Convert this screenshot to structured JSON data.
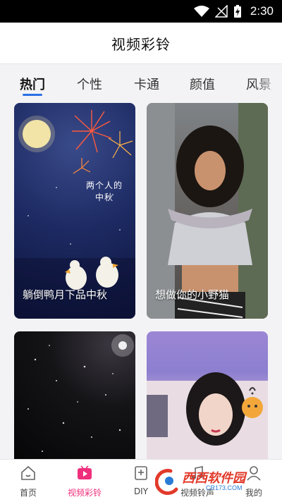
{
  "status_bar": {
    "time": "2:30"
  },
  "header": {
    "title": "视频彩铃"
  },
  "tabs": [
    {
      "label": "热门",
      "active": true
    },
    {
      "label": "个性"
    },
    {
      "label": "卡通"
    },
    {
      "label": "颜值"
    },
    {
      "label": "风景"
    }
  ],
  "cards": [
    {
      "caption": "躺倒鸭月下品中秋",
      "overlay_text": "两个人的中秋"
    },
    {
      "caption": "想做你的小野猫"
    },
    {
      "caption": ""
    },
    {
      "caption": ""
    }
  ],
  "bottom_nav": [
    {
      "label": "首页",
      "icon": "home-icon"
    },
    {
      "label": "视频彩铃",
      "icon": "video-ringtone-icon",
      "active": true
    },
    {
      "label": "DIY",
      "icon": "diy-icon"
    },
    {
      "label": "视频铃声",
      "icon": "ringtone-icon"
    },
    {
      "label": "我的",
      "icon": "profile-icon"
    }
  ],
  "watermark": {
    "text": "西西软件园",
    "subtext": "CR173.COM"
  },
  "colors": {
    "accent": "#ef2f7c",
    "tab_indicator": "#2b6fe6"
  }
}
